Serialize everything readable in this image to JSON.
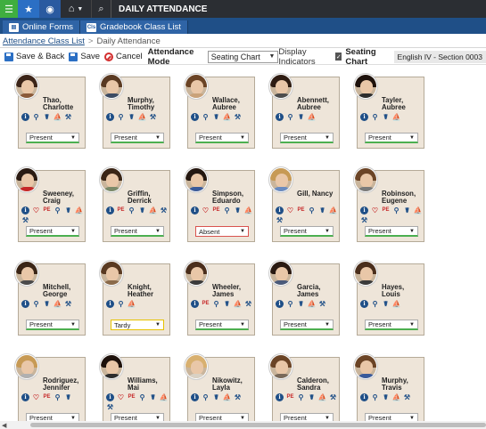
{
  "app": {
    "title": "DAILY ATTENDANCE"
  },
  "tabs": [
    {
      "label": "Online Forms",
      "icon": "form-icon"
    },
    {
      "label": "Gradebook Class List",
      "icon": "gradebook-icon",
      "icon_text": "Cls"
    }
  ],
  "breadcrumb": {
    "link": "Attendance Class List",
    "current": "Daily Attendance",
    "sep": ">"
  },
  "toolbar": {
    "save_back": "Save & Back",
    "save": "Save",
    "cancel": "Cancel",
    "mode_label": "Attendance Mode",
    "mode_value": "Seating Chart",
    "display_indicators": "Display Indicators",
    "seating_chart": "Seating Chart",
    "section": "English IV - Section 0003"
  },
  "colors": {
    "accent": "#1f4f87",
    "card": "#eee5d9",
    "present": "#4caf50",
    "absent": "#d9534f",
    "tardy": "#e6c200"
  },
  "students": [
    {
      "name": "Thao, Charlotte",
      "status": "Present",
      "icons": [
        "info-icon",
        "location-icon",
        "grad-cap-icon",
        "boat-icon",
        "wrench-icon"
      ],
      "hair": "#3b2418",
      "shirt": "#8a5a3a"
    },
    {
      "name": "Murphy, Timothy",
      "status": "Present",
      "icons": [
        "info-icon",
        "location-icon",
        "grad-cap-icon",
        "boat-icon",
        "wrench-icon"
      ],
      "hair": "#5a3a22",
      "shirt": "#3c4b63"
    },
    {
      "name": "Wallace, Aubree",
      "status": "Present",
      "icons": [
        "info-icon",
        "location-icon",
        "grad-cap-icon",
        "boat-icon",
        "wrench-icon"
      ],
      "hair": "#6b4426",
      "shirt": "#c9a27a"
    },
    {
      "name": "Abennett, Aubree",
      "status": "Present",
      "icons": [
        "info-icon",
        "location-icon",
        "grad-cap-icon",
        "boat-icon"
      ],
      "hair": "#2e1c12",
      "shirt": "#4d4d4d"
    },
    {
      "name": "Tayler, Aubree",
      "status": "Present",
      "icons": [
        "info-icon",
        "location-icon",
        "grad-cap-icon",
        "boat-icon"
      ],
      "hair": "#1e120c",
      "shirt": "#2d2d2d"
    },
    {
      "name": "Sweeney, Craig",
      "status": "Present",
      "icons": [
        "info-icon",
        "heart-icon",
        "no-pe-icon",
        "location-icon",
        "grad-cap-icon",
        "boat-icon",
        "wrench-icon"
      ],
      "hair": "#2a1a12",
      "shirt": "#c62828"
    },
    {
      "name": "Griffin, Derrick",
      "status": "Present",
      "icons": [
        "info-icon",
        "no-pe-icon",
        "location-icon",
        "grad-cap-icon",
        "boat-icon",
        "wrench-icon"
      ],
      "hair": "#3a2516",
      "shirt": "#7b8a6a"
    },
    {
      "name": "Simpson, Eduardo",
      "status": "Absent",
      "icons": [
        "info-icon",
        "heart-icon",
        "no-pe-icon",
        "location-icon",
        "grad-cap-icon",
        "boat-icon"
      ],
      "hair": "#241710",
      "shirt": "#3a5a9a"
    },
    {
      "name": "Gill, Nancy",
      "status": "Present",
      "icons": [
        "info-icon",
        "heart-icon",
        "no-pe-icon",
        "location-icon",
        "grad-cap-icon",
        "boat-icon",
        "wrench-icon"
      ],
      "hair": "#c79a55",
      "shirt": "#6a8bc0"
    },
    {
      "name": "Robinson, Eugene",
      "status": "Present",
      "icons": [
        "info-icon",
        "heart-icon",
        "no-pe-icon",
        "location-icon",
        "grad-cap-icon",
        "boat-icon",
        "wrench-icon"
      ],
      "hair": "#6b4426",
      "shirt": "#7a7a7a"
    },
    {
      "name": "Mitchell, George",
      "status": "Present",
      "icons": [
        "info-icon",
        "location-icon",
        "grad-cap-icon",
        "boat-icon",
        "wrench-icon"
      ],
      "hair": "#3a2516",
      "shirt": "#4a4a4a"
    },
    {
      "name": "Knight, Heather",
      "status": "Tardy",
      "icons": [
        "info-icon",
        "location-icon",
        "boat-icon"
      ],
      "hair": "#5a3a22",
      "shirt": "#8a6a4a"
    },
    {
      "name": "Wheeler, James",
      "status": "Present",
      "icons": [
        "info-icon",
        "no-pe-icon",
        "location-icon",
        "grad-cap-icon",
        "boat-icon",
        "wrench-icon"
      ],
      "hair": "#4a2e1c",
      "shirt": "#3a3a3a"
    },
    {
      "name": "Garcia, James",
      "status": "Present",
      "icons": [
        "info-icon",
        "location-icon",
        "grad-cap-icon",
        "boat-icon",
        "wrench-icon"
      ],
      "hair": "#2a1a12",
      "shirt": "#4a5a7a"
    },
    {
      "name": "Hayes, Louis",
      "status": "Present",
      "icons": [
        "info-icon",
        "location-icon",
        "grad-cap-icon",
        "boat-icon"
      ],
      "hair": "#4a2e1c",
      "shirt": "#3a3a3a"
    },
    {
      "name": "Rodriguez, Jennifer",
      "status": "Present",
      "icons": [
        "info-icon",
        "heart-icon",
        "no-pe-icon",
        "location-icon",
        "grad-cap-icon"
      ],
      "hair": "#c79a55",
      "shirt": "#b0b0b0"
    },
    {
      "name": "Williams, Mai",
      "status": "Present",
      "icons": [
        "info-icon",
        "heart-icon",
        "no-pe-icon",
        "location-icon",
        "grad-cap-icon",
        "boat-icon",
        "wrench-icon"
      ],
      "hair": "#1e120c",
      "shirt": "#2d2d2d"
    },
    {
      "name": "Nikowitz, Layla",
      "status": "Present",
      "icons": [
        "info-icon",
        "location-icon",
        "grad-cap-icon",
        "boat-icon",
        "wrench-icon"
      ],
      "hair": "#d8b070",
      "shirt": "#d9d1c4"
    },
    {
      "name": "Calderon, Sandra",
      "status": "Present",
      "icons": [
        "info-icon",
        "no-pe-icon",
        "location-icon",
        "grad-cap-icon",
        "boat-icon",
        "wrench-icon"
      ],
      "hair": "#6b4426",
      "shirt": "#7a6a5a"
    },
    {
      "name": "Murphy, Travis",
      "status": "Present",
      "icons": [
        "info-icon",
        "location-icon",
        "grad-cap-icon",
        "boat-icon",
        "wrench-icon"
      ],
      "hair": "#6b4426",
      "shirt": "#3a5a9a"
    }
  ]
}
